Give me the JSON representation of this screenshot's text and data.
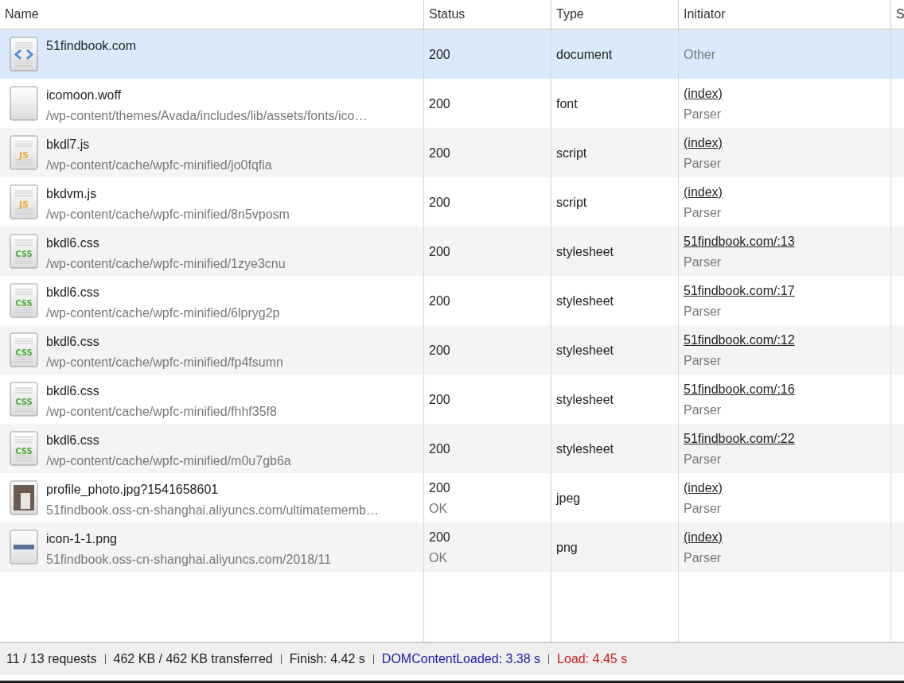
{
  "columns": [
    "Name",
    "Status",
    "Type",
    "Initiator",
    "S"
  ],
  "rows": [
    {
      "kind": "html",
      "name": "51findbook.com",
      "selected": true,
      "status": {
        "code": "200"
      },
      "type": "document",
      "initiator": {
        "kind": "plain",
        "text": "Other"
      }
    },
    {
      "kind": "blank",
      "name": "icomoon.woff",
      "path": "/wp-content/themes/Avada/includes/lib/assets/fonts/ico…",
      "selected": false,
      "status": {
        "code": "200"
      },
      "type": "font",
      "initiator": {
        "kind": "link",
        "text": "(index)",
        "detail": "Parser"
      }
    },
    {
      "kind": "js",
      "badge": "JS",
      "name": "bkdl7.js",
      "path": "/wp-content/cache/wpfc-minified/jo0fqfia",
      "selected": false,
      "status": {
        "code": "200"
      },
      "type": "script",
      "initiator": {
        "kind": "link",
        "text": "(index)",
        "detail": "Parser"
      }
    },
    {
      "kind": "js",
      "badge": "JS",
      "name": "bkdvm.js",
      "path": "/wp-content/cache/wpfc-minified/8n5vposm",
      "selected": false,
      "status": {
        "code": "200"
      },
      "type": "script",
      "initiator": {
        "kind": "link",
        "text": "(index)",
        "detail": "Parser"
      }
    },
    {
      "kind": "css",
      "badge": "CSS",
      "name": "bkdl6.css",
      "path": "/wp-content/cache/wpfc-minified/1zye3cnu",
      "selected": false,
      "status": {
        "code": "200"
      },
      "type": "stylesheet",
      "initiator": {
        "kind": "link",
        "text": "51findbook.com/:13",
        "detail": "Parser"
      }
    },
    {
      "kind": "css",
      "badge": "CSS",
      "name": "bkdl6.css",
      "path": "/wp-content/cache/wpfc-minified/6lpryg2p",
      "selected": false,
      "status": {
        "code": "200"
      },
      "type": "stylesheet",
      "initiator": {
        "kind": "link",
        "text": "51findbook.com/:17",
        "detail": "Parser"
      }
    },
    {
      "kind": "css",
      "badge": "CSS",
      "name": "bkdl6.css",
      "path": "/wp-content/cache/wpfc-minified/fp4fsumn",
      "selected": false,
      "status": {
        "code": "200"
      },
      "type": "stylesheet",
      "initiator": {
        "kind": "link",
        "text": "51findbook.com/:12",
        "detail": "Parser"
      }
    },
    {
      "kind": "css",
      "badge": "CSS",
      "name": "bkdl6.css",
      "path": "/wp-content/cache/wpfc-minified/fhhf35f8",
      "selected": false,
      "status": {
        "code": "200"
      },
      "type": "stylesheet",
      "initiator": {
        "kind": "link",
        "text": "51findbook.com/:16",
        "detail": "Parser"
      }
    },
    {
      "kind": "css",
      "badge": "CSS",
      "name": "bkdl6.css",
      "path": "/wp-content/cache/wpfc-minified/m0u7gb6a",
      "selected": false,
      "status": {
        "code": "200"
      },
      "type": "stylesheet",
      "initiator": {
        "kind": "link",
        "text": "51findbook.com/:22",
        "detail": "Parser"
      }
    },
    {
      "kind": "photo",
      "name": "profile_photo.jpg?1541658601",
      "path": "51findbook.oss-cn-shanghai.aliyuncs.com/ultimatememb…",
      "selected": false,
      "status": {
        "code": "200",
        "text": "OK"
      },
      "type": "jpeg",
      "initiator": {
        "kind": "link",
        "text": "(index)",
        "detail": "Parser"
      }
    },
    {
      "kind": "image",
      "name": "icon-1-1.png",
      "path": "51findbook.oss-cn-shanghai.aliyuncs.com/2018/11",
      "selected": false,
      "status": {
        "code": "200",
        "text": "OK"
      },
      "type": "png",
      "initiator": {
        "kind": "link",
        "text": "(index)",
        "detail": "Parser"
      }
    }
  ],
  "status_bar": [
    {
      "kind": "plain",
      "text": "11 / 13 requests"
    },
    {
      "kind": "plain",
      "text": "462 KB / 462 KB transferred"
    },
    {
      "kind": "plain",
      "text": "Finish: 4.42 s"
    },
    {
      "kind": "dom",
      "text": "DOMContentLoaded: 3.38 s"
    },
    {
      "kind": "load",
      "text": "Load: 4.45 s"
    }
  ]
}
